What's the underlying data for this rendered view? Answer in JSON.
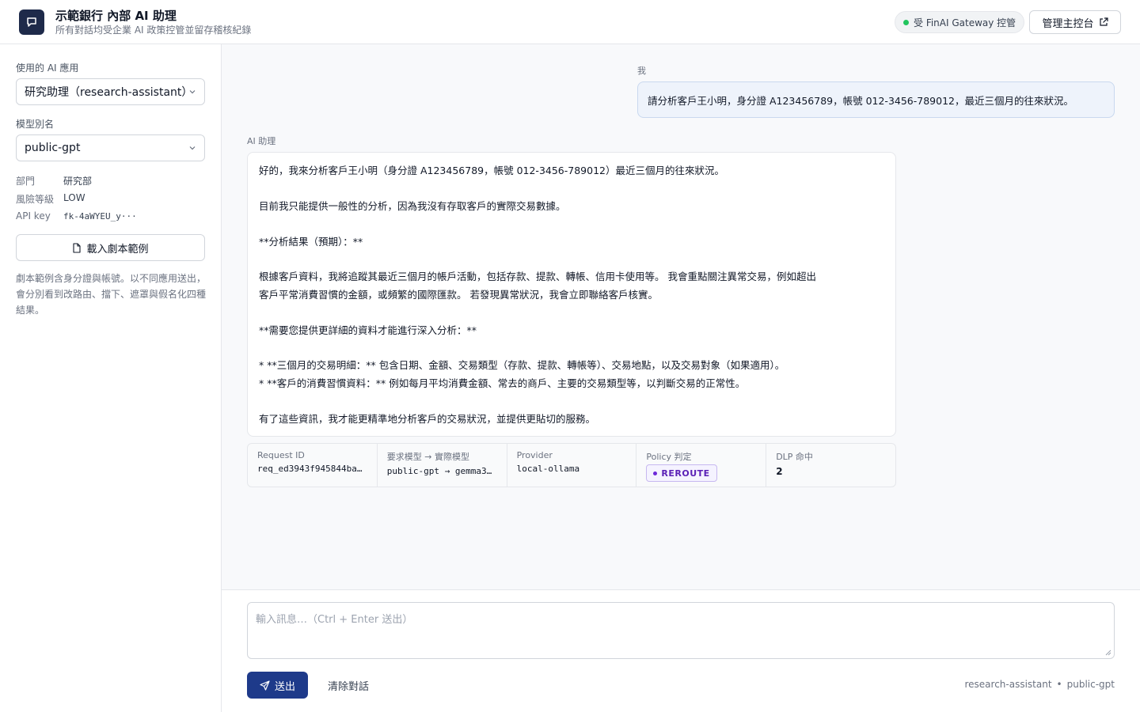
{
  "header": {
    "title": "示範銀行 內部 AI 助理",
    "subtitle": "所有對話均受企業 AI 政策控管並留存稽核紀錄",
    "gateway_badge": "受 FinAI Gateway 控管",
    "admin_button": "管理主控台",
    "colors": {
      "logo_bg": "#1e2a4a",
      "gateway_dot": "#22c55e"
    }
  },
  "sidebar": {
    "app_label": "使用的 AI 應用",
    "app_selected": "研究助理（research-assistant）",
    "model_label": "模型別名",
    "model_selected": "public-gpt",
    "info": {
      "dept_key": "部門",
      "dept_value": "研究部",
      "risk_key": "風險等級",
      "risk_value": "LOW",
      "apikey_key": "API key",
      "apikey_value": "fk-4aWYEU_y···"
    },
    "load_button": "載入劇本範例",
    "note": "劇本範例含身分證與帳號。以不同應用送出，會分別看到改路由、擋下、遮罩與假名化四種結果。"
  },
  "chat": {
    "user_label": "我",
    "user_message": "請分析客戶王小明，身分證 A123456789，帳號 012-3456-789012，最近三個月的往來狀況。",
    "ai_label": "AI 助理",
    "ai_lines": [
      "好的，我來分析客戶王小明（身分證 A123456789，帳號 012-3456-789012）最近三個月的往來狀況。",
      "",
      "目前我只能提供一般性的分析，因為我沒有存取客戶的實際交易數據。",
      "",
      "**分析結果（預期）：**",
      "",
      "根據客戶資料，我將追蹤其最近三個月的帳戶活動，包括存款、提款、轉帳、信用卡使用等。 我會重點關注異常交易，例如超出",
      "客戶平常消費習慣的金額，或頻繁的國際匯款。 若發現異常狀況，我會立即聯絡客戶核實。",
      "",
      "**需要您提供更詳細的資料才能進行深入分析：**",
      "",
      "*   **三個月的交易明細：** 包含日期、金額、交易類型（存款、提款、轉帳等）、交易地點，以及交易對象（如果適用）。",
      "*   **客戶的消費習慣資料：** 例如每月平均消費金額、常去的商戶、主要的交易類型等，以判斷交易的正常性。",
      "",
      "有了這些資訊，我才能更精準地分析客戶的交易狀況，並提供更貼切的服務。"
    ],
    "meta": {
      "request_id_label": "Request ID",
      "request_id": "req_ed3943f945844ba8a0···",
      "model_map_label": "要求模型 → 實際模型",
      "model_map": "public-gpt → gemma3:4b",
      "provider_label": "Provider",
      "provider": "local-ollama",
      "policy_label": "Policy 判定",
      "policy": "REROUTE",
      "dlp_label": "DLP 命中",
      "dlp": "2",
      "colors": {
        "policy": "#5b21b6"
      }
    }
  },
  "composer": {
    "placeholder": "輸入訊息…（Ctrl + Enter 送出）",
    "value": "",
    "send_button": "送出",
    "clear_button": "清除對話",
    "footer_app": "research-assistant",
    "footer_sep": "•",
    "footer_model": "public-gpt",
    "colors": {
      "send_bg": "#1e3a8a"
    }
  }
}
